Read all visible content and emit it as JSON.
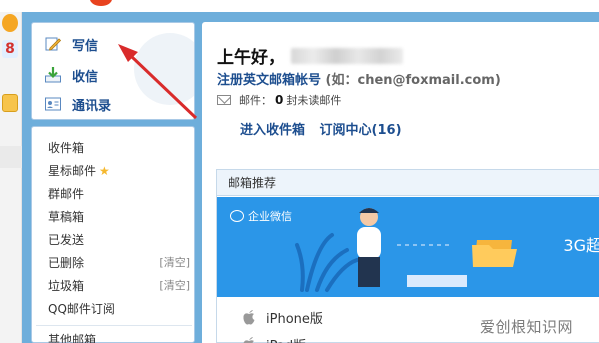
{
  "nav": {
    "write_label": "写信",
    "receive_label": "收信",
    "contacts_label": "通讯录",
    "folders": [
      {
        "label": "收件箱",
        "action": ""
      },
      {
        "label": "星标邮件",
        "action": ""
      },
      {
        "label": "群邮件",
        "action": ""
      },
      {
        "label": "草稿箱",
        "action": ""
      },
      {
        "label": "已发送",
        "action": ""
      },
      {
        "label": "已删除",
        "action": "[清空]"
      },
      {
        "label": "垃圾箱",
        "action": "[清空]"
      },
      {
        "label": "QQ邮件订阅",
        "action": ""
      },
      {
        "label": "其他邮箱",
        "action": ""
      }
    ]
  },
  "main": {
    "greeting": "上午好，",
    "register_link": "注册英文邮箱帐号",
    "register_hint": "(如：chen@foxmail.com)",
    "mail_label": "邮件：",
    "unread_count": "0",
    "unread_suffix": "封未读邮件",
    "inbox_link": "进入收件箱",
    "subscription_link": "订阅中心(16)",
    "recommend_title": "邮箱推荐",
    "banner_label": "企业微信",
    "banner_right_text": "3G超",
    "apps": [
      "iPhone版",
      "iPad版"
    ]
  },
  "edge": {
    "number_glyph": "8"
  },
  "watermark": "爱创根知识网",
  "colors": {
    "background_blue": "#6eaedb",
    "link_blue": "#1d4e8f",
    "banner_blue": "#2b96e8",
    "arrow_red": "#d92b2b"
  }
}
